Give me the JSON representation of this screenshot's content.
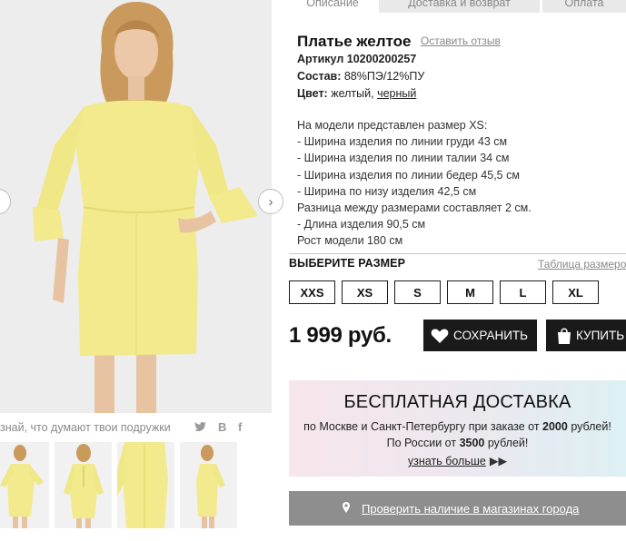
{
  "tabs": [
    {
      "label": "Описание",
      "active": true
    },
    {
      "label": "Доставка и возврат",
      "active": false
    },
    {
      "label": "Оплата",
      "active": false
    }
  ],
  "product": {
    "title": "Платье желтое",
    "review_link": "Оставить отзыв",
    "sku_label": "Артикул",
    "sku_value": "10200200257",
    "composition_label": "Состав:",
    "composition_value": "88%ПЭ/12%ПУ",
    "color_label": "Цвет:",
    "color_current": "желтый,",
    "color_alt": "черный"
  },
  "description": [
    "На модели представлен размер XS:",
    "- Ширина изделия по линии груди 43 см",
    "- Ширина изделия по линии талии 34 см",
    "- Ширина изделия по линии бедер 45,5 см",
    "- Ширина по низу изделия 42,5 см",
    "Разница между размерами составляет 2 см.",
    "- Длина изделия 90,5 см",
    "Рост модели 180 см"
  ],
  "sizes": {
    "title": "ВЫБЕРИТЕ РАЗМЕР",
    "table_link": "Таблица размеров",
    "options": [
      "XXS",
      "XS",
      "S",
      "M",
      "L",
      "XL"
    ]
  },
  "price": "1 999 руб.",
  "actions": {
    "save": "СОХРАНИТЬ",
    "buy": "КУПИТЬ"
  },
  "delivery": {
    "title": "БЕСПЛАТНАЯ ДОСТАВКА",
    "line1_pre": "по Москве и Санкт-Петербургу при заказе от",
    "line1_amount": "2000",
    "line1_post": "рублей!",
    "line2_pre": "По России от",
    "line2_amount": "3500",
    "line2_post": "рублей!",
    "more": "узнать больше",
    "more_arrows": "▶▶"
  },
  "stock_check": "Проверить наличие в магазинах города",
  "share": {
    "text": "знай, что думают твои подружки",
    "icons": [
      "twitter-icon",
      "vk-icon",
      "facebook-icon"
    ],
    "vk_glyph": "B",
    "fb_glyph": "f"
  },
  "gallery": {
    "prev_glyph": "‹",
    "next_glyph": "›",
    "thumbnail_count": 4
  },
  "colors": {
    "dress": "#f2ea8c",
    "dress_shadow": "#e3d970",
    "dark_button": "#1a1a1a",
    "stock_button": "#8e8e8e"
  }
}
